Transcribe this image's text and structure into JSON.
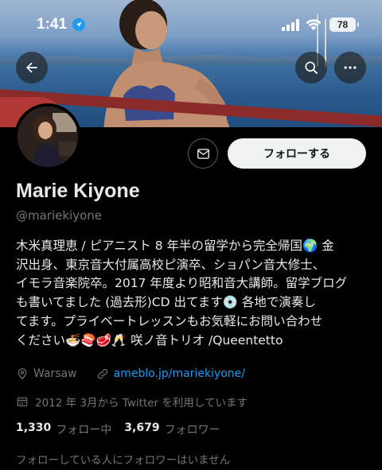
{
  "status_bar": {
    "time": "1:41",
    "battery": "78"
  },
  "profile": {
    "name": "Marie Kiyone",
    "handle": "@mariekiyone",
    "bio_lines": [
      "木米真理恵 / ピアニスト 8 年半の留学から完全帰国🌍 金",
      "沢出身、東京音大付属高校ピ演卒、ショパン音大修士、",
      "イモラ音楽院卒。2017 年度より昭和音大講師。留学ブログ",
      "も書いてました (過去形)CD 出てます💿 各地で演奏し",
      "てます。プライベートレッスンもお気軽にお問い合わせ",
      "ください🍜🍣🥩🥂 咲ノ音トリオ /Queentetto"
    ],
    "location": "Warsaw",
    "link": "ameblo.jp/mariekiyone/",
    "joined": "2012 年 3月から Twitter を利用しています",
    "following_count": "1,330",
    "following_label": "フォロー中",
    "followers_count": "3,679",
    "followers_label": "フォロワー",
    "no_followers_you_know": "フォローしている人にフォロワーはいません"
  },
  "actions": {
    "follow_label": "フォローする"
  },
  "icons": {
    "back": "arrow-left-icon",
    "search": "search-icon",
    "more": "more-icon",
    "message": "mail-icon",
    "location": "location-pin-icon",
    "link": "link-icon",
    "calendar": "calendar-icon"
  },
  "colors": {
    "background": "#000000",
    "accent_link": "#1d9bf0",
    "secondary_text": "#71767b",
    "primary_text": "#e7e9ea",
    "follow_button_bg": "#eff3f4"
  }
}
